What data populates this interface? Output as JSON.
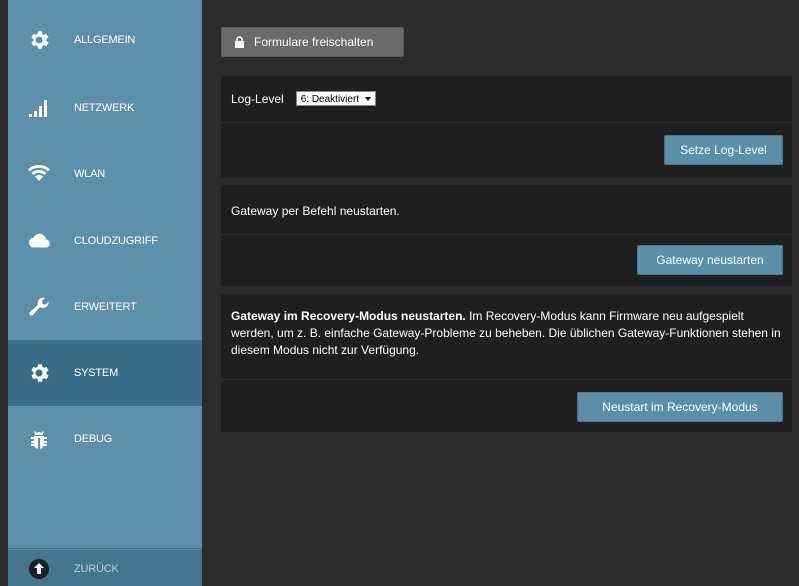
{
  "sidebar": {
    "items": [
      {
        "label": "ALLGEMEIN",
        "icon": "gear-icon"
      },
      {
        "label": "NETZWERK",
        "icon": "signal-bars-icon"
      },
      {
        "label": "WLAN",
        "icon": "wifi-icon"
      },
      {
        "label": "CLOUDZUGRIFF",
        "icon": "cloud-icon"
      },
      {
        "label": "ERWEITERT",
        "icon": "wrench-icon"
      },
      {
        "label": "SYSTEM",
        "icon": "gear-icon",
        "active": true
      },
      {
        "label": "DEBUG",
        "icon": "bug-icon"
      }
    ],
    "back": {
      "label": "ZURÜCK",
      "icon": "arrow-up-circle-icon"
    }
  },
  "main": {
    "unlock_button": "Formulare freischalten",
    "log_panel": {
      "label": "Log-Level",
      "select_value": "6: Deaktiviert",
      "button": "Setze Log-Level"
    },
    "restart_panel": {
      "text": "Gateway per Befehl neustarten.",
      "button": "Gateway neustarten"
    },
    "recovery_panel": {
      "bold": "Gateway im Recovery-Modus neustarten.",
      "text": " Im Recovery-Modus kann Firmware neu aufgespielt werden, um z. B. einfache Gateway-Probleme zu beheben. Die üblichen Gateway-Funktionen stehen in diesem Modus nicht zur Verfügung.",
      "button": "Neustart im Recovery-Modus"
    }
  },
  "colors": {
    "sidebar": "#5e8fa9",
    "sidebar_active": "#3b6d86",
    "background": "#2b2b2b",
    "panel": "#1f1f1f",
    "button": "#5b8fa8"
  }
}
